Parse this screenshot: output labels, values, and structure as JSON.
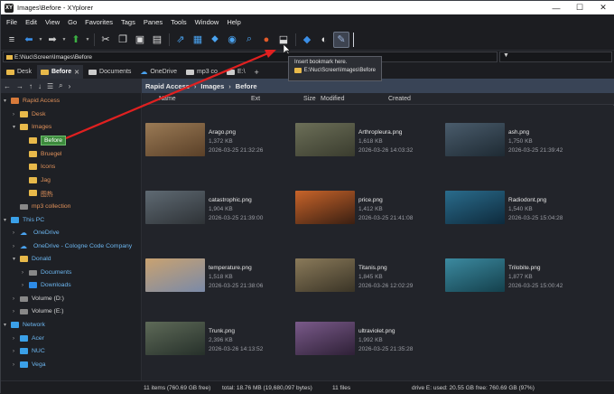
{
  "window": {
    "title": "Images\\Before - XYplorer",
    "app_icon": "XY"
  },
  "menu": [
    "File",
    "Edit",
    "View",
    "Go",
    "Favorites",
    "Tags",
    "Panes",
    "Tools",
    "Window",
    "Help"
  ],
  "toolbar": {
    "icons": [
      "menu-icon",
      "back-icon",
      "forward-icon",
      "up-icon",
      "cut-icon",
      "copy-icon",
      "paste-icon",
      "clipboard-icon",
      "share-icon",
      "preview-icon",
      "tag-icon",
      "map-icon",
      "search-icon",
      "fire-icon",
      "gem-icon",
      "moon-icon",
      "wrench-icon"
    ]
  },
  "tooltip": {
    "line1": "Insert bookmark here.",
    "line2": "E:\\Nuc\\Screen\\Images\\Before"
  },
  "address": {
    "path": "E:\\Nuc\\Screen\\Images\\Before"
  },
  "tabs": [
    {
      "label": "Desk",
      "active": false
    },
    {
      "label": "Before",
      "active": true
    },
    {
      "label": "Documents",
      "active": false
    },
    {
      "label": "OneDrive",
      "active": false
    },
    {
      "label": "mp3 co",
      "active": false
    },
    {
      "label": "E:\\",
      "active": false
    }
  ],
  "crumbs": [
    "Rapid Access",
    "Images",
    "Before"
  ],
  "tree": {
    "rapid_access": "Rapid Access",
    "desk": "Desk",
    "images": "Images",
    "before": "Before",
    "bruegel": "Bruegel",
    "icons": "Icons",
    "jag": "Jag",
    "cn": "图热",
    "mp3": "mp3 collection",
    "this_pc": "This PC",
    "onedrive": "OneDrive",
    "onedrive_company": "OneDrive - Cologne Code Company",
    "donald": "Donald",
    "documents": "Documents",
    "downloads": "Downloads",
    "vol_d": "Volume (D:)",
    "vol_e": "Volume (E:)",
    "network": "Network",
    "acer": "Acer",
    "nuc": "NUC",
    "vega": "Vega"
  },
  "columns": {
    "name": "Name",
    "ext": "Ext",
    "size": "Size",
    "modified": "Modified",
    "created": "Created"
  },
  "files": [
    {
      "name": "Arago.png",
      "size": "1,372 KB",
      "date": "2026-03-25 21:32:26",
      "c1": "#9a7a55",
      "c2": "#5a4028"
    },
    {
      "name": "Arthropleura.png",
      "size": "1,618 KB",
      "date": "2026-03-26 14:03:32",
      "c1": "#6c6f58",
      "c2": "#3a3c2e"
    },
    {
      "name": "ash.png",
      "size": "1,750 KB",
      "date": "2026-03-25 21:39:42",
      "c1": "#4a5c6c",
      "c2": "#1e2a33"
    },
    {
      "name": "catastrophic.png",
      "size": "1,904 KB",
      "date": "2026-03-25 21:39:00",
      "c1": "#5f6a73",
      "c2": "#2e3236"
    },
    {
      "name": "price.png",
      "size": "1,412 KB",
      "date": "2026-03-25 21:41:08",
      "c1": "#c8642a",
      "c2": "#3a1f12"
    },
    {
      "name": "Radiodont.png",
      "size": "1,540 KB",
      "date": "2026-03-25 15:04:28",
      "c1": "#2a6c8c",
      "c2": "#0e2a3c"
    },
    {
      "name": "temperature.png",
      "size": "1,518 KB",
      "date": "2026-03-25 21:38:06",
      "c1": "#c9a270",
      "c2": "#7a8aa8"
    },
    {
      "name": "Titanis.png",
      "size": "1,845 KB",
      "date": "2026-03-26 12:02:29",
      "c1": "#8a7a5a",
      "c2": "#3a3426"
    },
    {
      "name": "Trilobite.png",
      "size": "1,877 KB",
      "date": "2026-03-25 15:00:42",
      "c1": "#3c8aa0",
      "c2": "#14404c"
    },
    {
      "name": "Trunk.png",
      "size": "2,396 KB",
      "date": "2026-03-26 14:13:52",
      "c1": "#5e6a58",
      "c2": "#26302a"
    },
    {
      "name": "ultraviolet.png",
      "size": "1,992 KB",
      "date": "2026-03-25 21:35:28",
      "c1": "#7a5a8a",
      "c2": "#2e2036"
    }
  ],
  "status": {
    "items": "11 items (760.69 GB free)",
    "total": "total: 18.76 MB (19,680,097 bytes)",
    "files": "11 files",
    "drive": "drive E:  used: 20.55 GB  free: 760.69 GB (97%)"
  },
  "colors": {
    "accent": "#3d8b3d",
    "arrow": "#e02020",
    "folder": "#e8b94a"
  }
}
